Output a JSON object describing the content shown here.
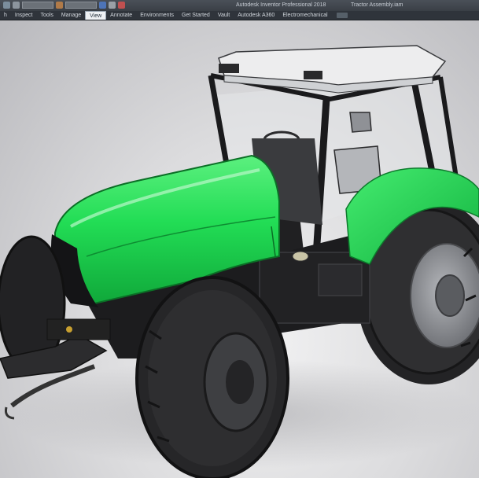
{
  "window": {
    "app_title": "Autodesk Inventor Professional 2018",
    "document_title": "Tractor Assembly.iam"
  },
  "ribbon": {
    "tabs": [
      {
        "label": "h"
      },
      {
        "label": "Inspect"
      },
      {
        "label": "Tools"
      },
      {
        "label": "Manage"
      },
      {
        "label": "View"
      },
      {
        "label": "Annotate"
      },
      {
        "label": "Environments"
      },
      {
        "label": "Get Started"
      },
      {
        "label": "Vault"
      },
      {
        "label": "Autodesk A360"
      },
      {
        "label": "Electromechanical"
      }
    ],
    "active_tab": "View"
  },
  "viewport": {
    "model": "tractor-assembly-3d-model",
    "colors": {
      "hood_green": "#22dd55",
      "hood_green_dark": "#10a83a",
      "body_black": "#1c1c1e",
      "tire": "#2a2a2c",
      "rim": "#8d8f94",
      "cab_frame": "#1a1a1c",
      "cab_roof": "#e9e9ea",
      "background": "#d7d7d9"
    }
  }
}
